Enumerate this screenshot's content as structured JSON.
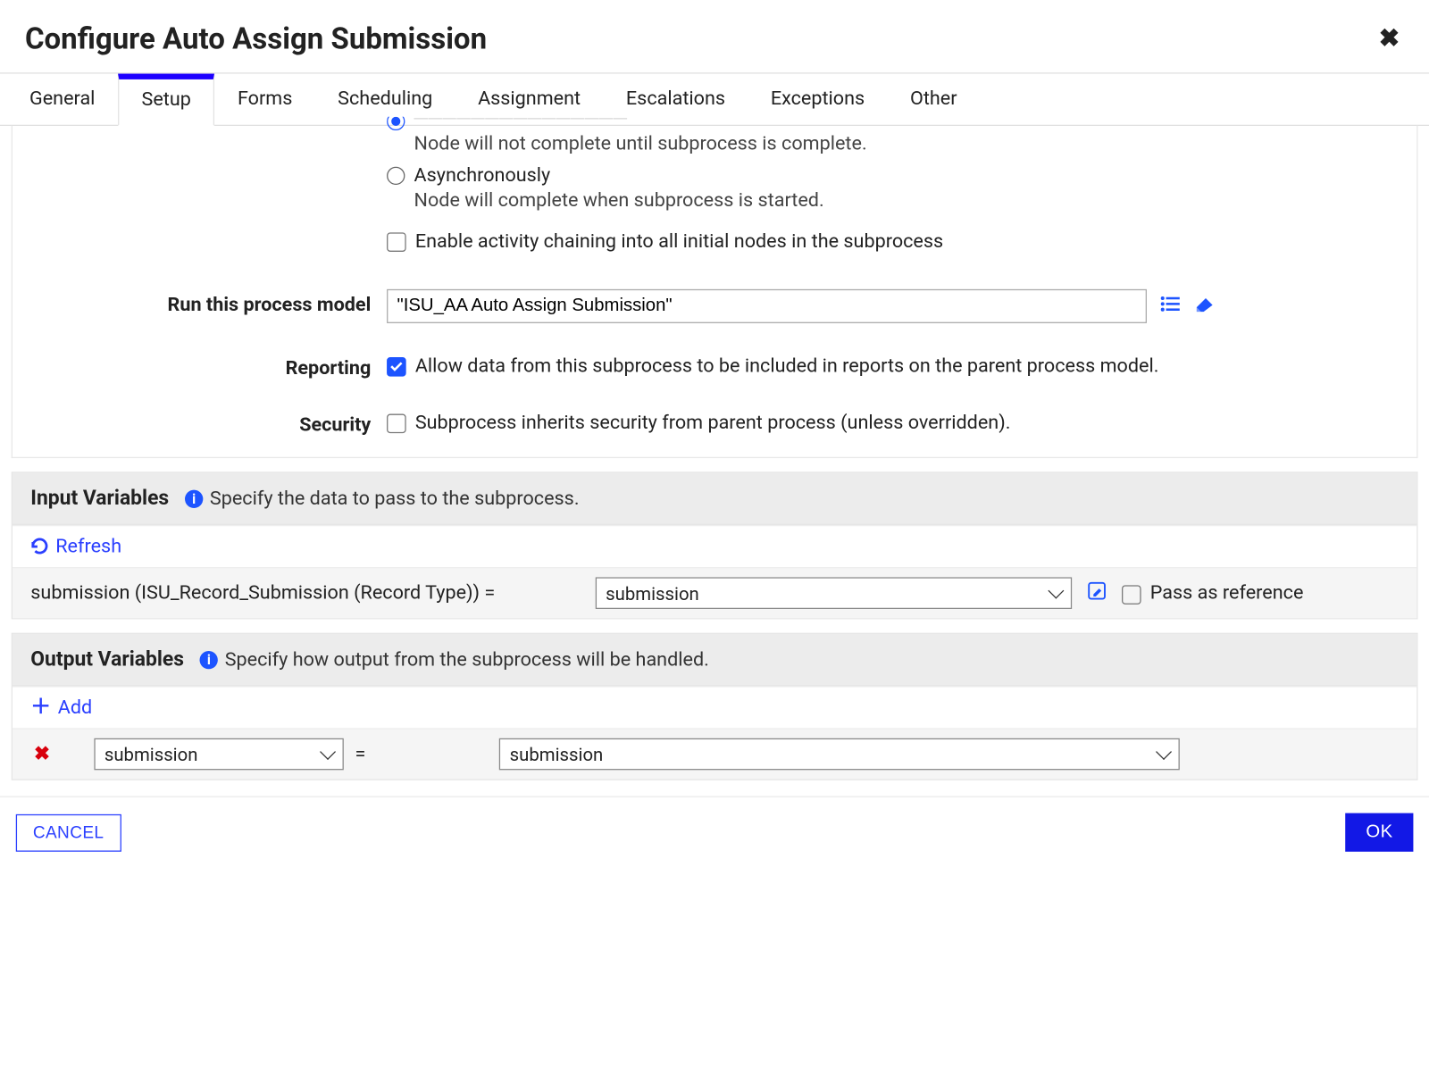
{
  "header": {
    "title": "Configure Auto Assign Submission"
  },
  "tabs": {
    "items": [
      {
        "label": "General"
      },
      {
        "label": "Setup"
      },
      {
        "label": "Forms"
      },
      {
        "label": "Scheduling"
      },
      {
        "label": "Assignment"
      },
      {
        "label": "Escalations"
      },
      {
        "label": "Exceptions"
      },
      {
        "label": "Other"
      }
    ],
    "active_index": 1
  },
  "form": {
    "sync": {
      "desc": "Node will not complete until subprocess is complete."
    },
    "async": {
      "label": "Asynchronously",
      "desc": "Node will complete when subprocess is started."
    },
    "chaining": {
      "label": "Enable activity chaining into all initial nodes in the subprocess"
    },
    "process_model": {
      "label": "Run this process model",
      "value": "\"ISU_AA Auto Assign Submission\""
    },
    "reporting": {
      "label": "Reporting",
      "text": "Allow data from this subprocess to be included in reports on the parent process model."
    },
    "security": {
      "label": "Security",
      "text": "Subprocess inherits security from parent process (unless overridden)."
    }
  },
  "input_vars": {
    "title": "Input Variables",
    "hint": "Specify the data to pass to the subprocess.",
    "refresh": "Refresh",
    "row": {
      "label": "submission (ISU_Record_Submission (Record Type)) =",
      "value": "submission",
      "pass_ref": "Pass as reference"
    }
  },
  "output_vars": {
    "title": "Output Variables",
    "hint": "Specify how output from the subprocess will be handled.",
    "add": "Add",
    "row": {
      "left": "submission",
      "right": "submission"
    }
  },
  "footer": {
    "cancel": "CANCEL",
    "ok": "OK"
  }
}
